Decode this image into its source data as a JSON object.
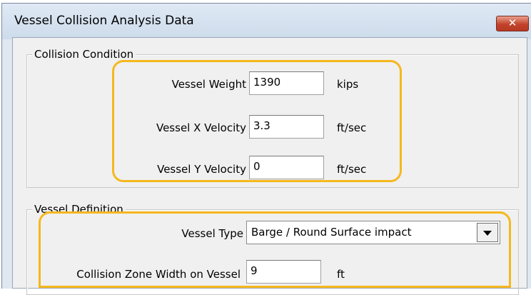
{
  "window": {
    "title": "Vessel Collision Analysis Data",
    "close_glyph": "✕"
  },
  "collision_condition": {
    "legend": "Collision Condition",
    "fields": [
      {
        "label": "Vessel Weight",
        "value": "1390",
        "unit": "kips"
      },
      {
        "label": "Vessel X Velocity",
        "value": "3.3",
        "unit": "ft/sec"
      },
      {
        "label": "Vessel Y Velocity",
        "value": "0",
        "unit": "ft/sec"
      }
    ]
  },
  "vessel_definition": {
    "legend": "Vessel Definition",
    "vessel_type": {
      "label": "Vessel Type",
      "selected": "Barge / Round Surface impact"
    },
    "collision_zone": {
      "label": "Collision Zone Width on Vessel",
      "value": "9",
      "unit": "ft"
    }
  },
  "highlight_color": "#f5b81e"
}
